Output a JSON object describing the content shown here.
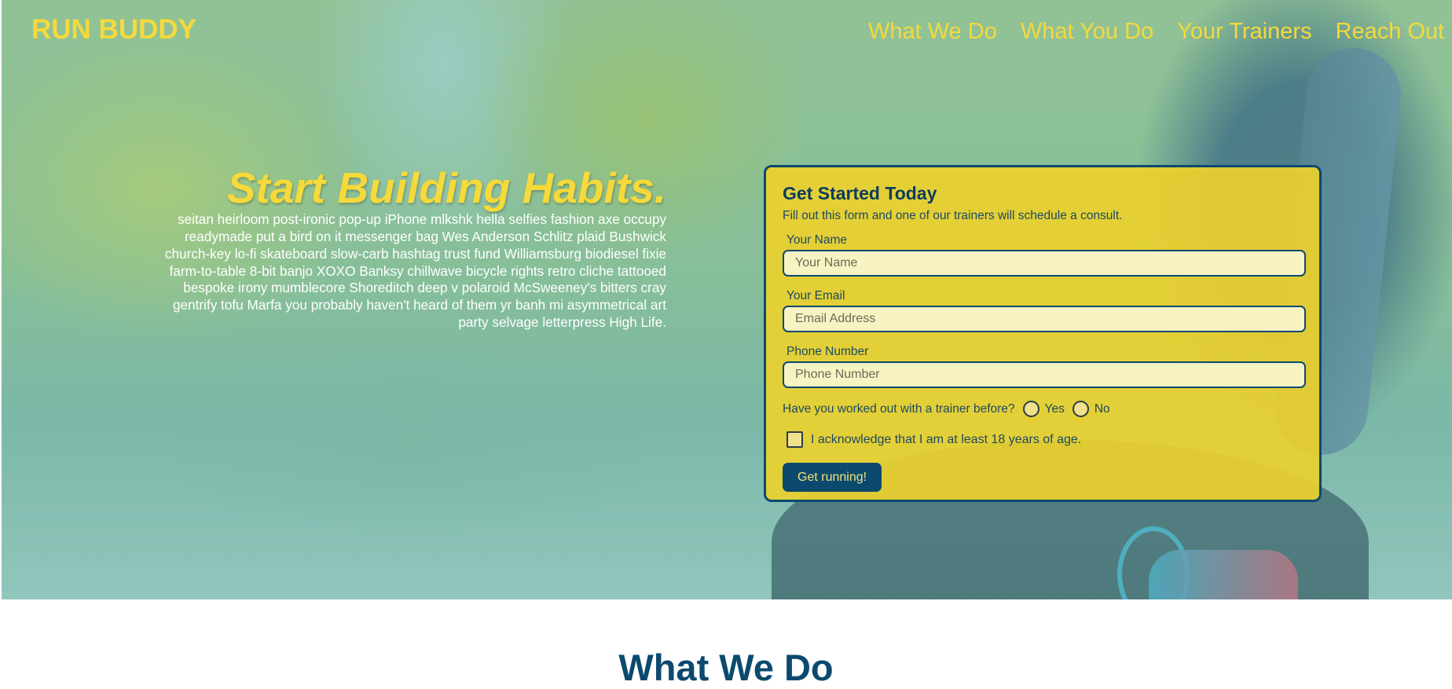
{
  "header": {
    "logo": "RUN BUDDY",
    "nav": [
      "What We Do",
      "What You Do",
      "Your Trainers",
      "Reach Out"
    ]
  },
  "hero": {
    "title": "Start Building Habits.",
    "body": "seitan heirloom post-ironic pop-up iPhone mlkshk hella selfies fashion axe occupy readymade put a bird on it messenger bag Wes Anderson Schlitz plaid Bushwick church-key lo-fi skateboard slow-carb hashtag trust fund Williamsburg biodiesel fixie farm-to-table 8-bit banjo XOXO Banksy chillwave bicycle rights retro cliche tattooed bespoke irony mumblecore Shoreditch deep v polaroid McSweeney's bitters cray gentrify tofu Marfa you probably haven't heard of them yr banh mi asymmetrical art party selvage letterpress High Life."
  },
  "form": {
    "title": "Get Started Today",
    "intro": "Fill out this form and one of our trainers will schedule a consult.",
    "name_label": "Your Name",
    "name_placeholder": "Your Name",
    "email_label": "Your Email",
    "email_placeholder": "Email Address",
    "phone_label": "Phone Number",
    "phone_placeholder": "Phone Number",
    "trainer_question": "Have you worked out with a trainer before?",
    "yes_label": "Yes",
    "no_label": "No",
    "acknowledge": "I acknowledge that I am at least 18 years of age.",
    "submit": "Get running!"
  },
  "section": {
    "title": "What We Do"
  },
  "colors": {
    "accent_yellow": "#f5da3b",
    "navy": "#0b4a6e",
    "form_bg": "#ecd02e"
  }
}
